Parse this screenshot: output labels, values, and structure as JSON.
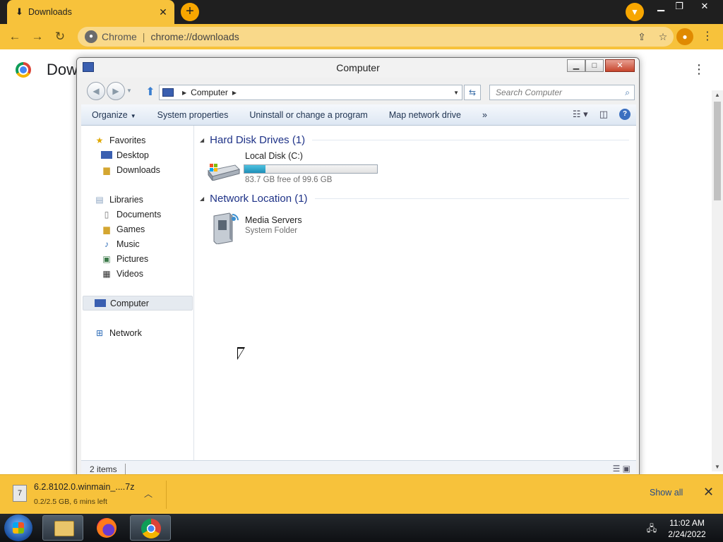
{
  "browser": {
    "tab": {
      "title": "Downloads",
      "icon": "download-icon"
    },
    "omnibox": {
      "scheme_label": "Chrome",
      "url": "chrome://downloads"
    },
    "page_title": "Downloads",
    "accent_color": "#f7c23b"
  },
  "explorer": {
    "title": "Computer",
    "address": {
      "location": "Computer"
    },
    "search_placeholder": "Search Computer",
    "commands": [
      "Organize",
      "System properties",
      "Uninstall or change a program",
      "Map network drive"
    ],
    "overflow_label": "»",
    "nav": {
      "favorites": {
        "label": "Favorites",
        "items": [
          "Desktop",
          "Downloads"
        ]
      },
      "libraries": {
        "label": "Libraries",
        "items": [
          "Documents",
          "Games",
          "Music",
          "Pictures",
          "Videos"
        ]
      },
      "computer": "Computer",
      "network": "Network"
    },
    "groups": {
      "hard_disks": {
        "header": "Hard Disk Drives (1)",
        "drive": {
          "name": "Local Disk (C:)",
          "free_text": "83.7 GB free of 99.6 GB",
          "used_fraction": 0.16
        }
      },
      "network_locations": {
        "header": "Network Location (1)",
        "item": {
          "name": "Media Servers",
          "type": "System Folder"
        }
      }
    },
    "status": "2 items"
  },
  "download_shelf": {
    "file_name": "6.2.8102.0.winmain_....7z",
    "status": "0.2/2.5 GB, 6 mins left",
    "show_all": "Show all"
  },
  "taskbar": {
    "time": "11:02 AM",
    "date": "2/24/2022"
  }
}
